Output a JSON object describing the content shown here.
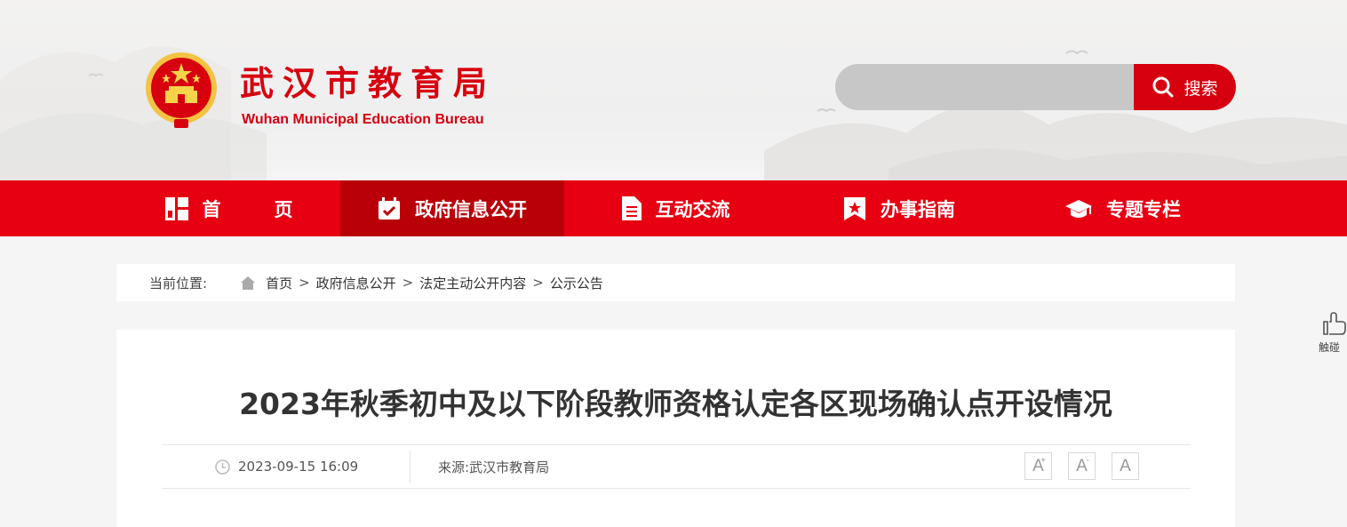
{
  "header": {
    "title_zh": "武汉市教育局",
    "title_en": "Wuhan Municipal Education Bureau",
    "emblem": "national-emblem",
    "search": {
      "placeholder": "",
      "button_label": "搜索",
      "icon": "search-icon"
    }
  },
  "nav": {
    "items": [
      {
        "label": "首页",
        "label_chars": [
          "首",
          "页"
        ],
        "icon": "grid-icon",
        "active": false
      },
      {
        "label": "政府信息公开",
        "icon": "calendar-check-icon",
        "active": true
      },
      {
        "label": "互动交流",
        "icon": "document-icon",
        "active": false
      },
      {
        "label": "办事指南",
        "icon": "bookmark-star-icon",
        "active": false
      },
      {
        "label": "专题专栏",
        "icon": "graduation-cap-icon",
        "active": false
      }
    ]
  },
  "breadcrumb": {
    "prefix": "当前位置:",
    "items": [
      "首页",
      "政府信息公开",
      "法定主动公开内容",
      "公示公告"
    ],
    "separator": ">"
  },
  "article": {
    "title": "2023年秋季初中及以下阶段教师资格认定各区现场确认点开设情况",
    "datetime": "2023-09-15 16:09",
    "source_label": "来源:",
    "source": "武汉市教育局",
    "font_buttons": [
      "A",
      "A",
      "A"
    ]
  },
  "float": {
    "label": "触碰",
    "icon": "touch-hand-icon"
  },
  "colors": {
    "primary_red": "#e60012",
    "active_red": "#b90009",
    "brand_text": "#d7000f",
    "search_bg": "#c8c7c8"
  }
}
